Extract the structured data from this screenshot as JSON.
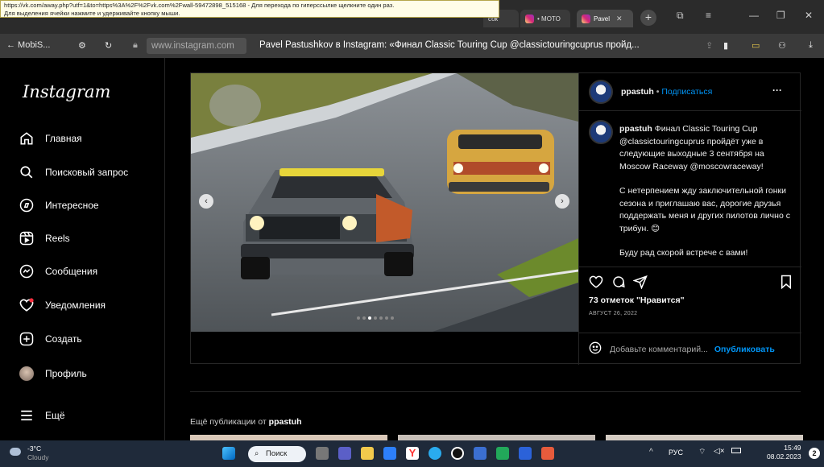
{
  "tooltip": {
    "line1": "https://vk.com/away.php?utf=1&to=https%3A%2F%2Fvk.com%2Fwall-59472898_515168 - Для перехода по гиперссылке щелкните один раз.",
    "line2": "Для выделения ячейки нажмите и удерживайте кнопку мыши."
  },
  "tabs": [
    {
      "label": "сок"
    },
    {
      "label": "• MOTO"
    },
    {
      "label": "Pavel"
    }
  ],
  "addressbar": {
    "back_label": "← MobiS...",
    "url": "www.instagram.com",
    "page_title": "Pavel Pastushkov в Instagram: «Финал Classic Touring Cup @classictouringcuprus пройд..."
  },
  "sidebar": {
    "logo": "Instagram",
    "items": [
      {
        "label": "Главная",
        "icon": "home-icon"
      },
      {
        "label": "Поисковый запрос",
        "icon": "search-icon"
      },
      {
        "label": "Интересное",
        "icon": "compass-icon"
      },
      {
        "label": "Reels",
        "icon": "reels-icon"
      },
      {
        "label": "Сообщения",
        "icon": "messenger-icon"
      },
      {
        "label": "Уведомления",
        "icon": "heart-icon"
      },
      {
        "label": "Создать",
        "icon": "plus-square-icon"
      },
      {
        "label": "Профиль",
        "icon": "avatar-icon"
      }
    ],
    "more": "Ещё"
  },
  "post": {
    "username": "ppastuh",
    "dot": "•",
    "follow": "Подписаться",
    "menu": "···",
    "caption_user": "ppastuh",
    "caption_p1": "Финал Classic Touring Cup @classictouringcuprus пройдёт уже в следующие выходные 3 сентября на Moscow Raceway @moscowraceway!",
    "caption_p2": "С нетерпением жду заключительной гонки сезона и приглашаю вас, дорогие друзья поддержать меня и других пилотов лично с трибун. 😊",
    "caption_p3": "Буду рад скорой встрече с вами!",
    "likes": "73 отметок \"Нравится\"",
    "date": "АВГУСТ 26, 2022",
    "comment_placeholder": "Добавьте комментарий...",
    "publish": "Опубликовать",
    "carousel_count": 7,
    "carousel_active": 2
  },
  "more_posts": {
    "prefix": "Ещё публикации от",
    "user": "ppastuh"
  },
  "taskbar": {
    "weather_temp": "-3°C",
    "weather_text": "Cloudy",
    "search_label": "Поиск",
    "lang": "РУС",
    "time": "15:49",
    "date": "08.02.2023",
    "notif": "2"
  },
  "colors": {
    "link": "#0095f6",
    "bg": "#000000"
  }
}
